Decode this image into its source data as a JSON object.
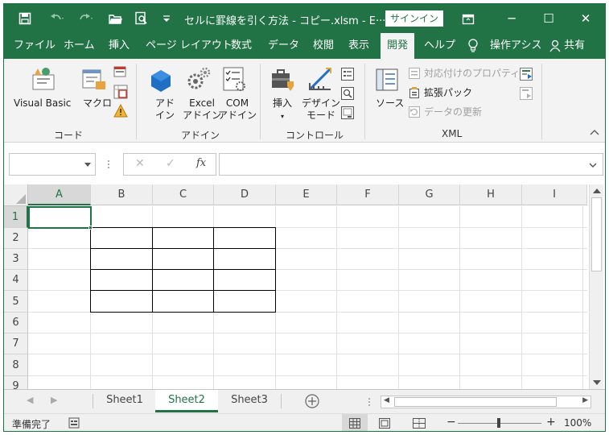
{
  "titlebar": {
    "title": "セルに罫線を引く方法 - コピー.xlsm  -  E···",
    "signin_label": "サインイン",
    "minimize_glyph": "─",
    "maximize_glyph": "☐",
    "close_glyph": "✕"
  },
  "tabs": [
    "ファイル",
    "ホーム",
    "挿入",
    "ページ レイアウト",
    "数式",
    "データ",
    "校閲",
    "表示",
    "開発",
    "ヘルプ",
    "操作アシス",
    "共有"
  ],
  "active_tab": "開発",
  "ribbon": {
    "code_group": {
      "label": "コード",
      "visual_basic": "Visual Basic",
      "macro": "マクロ"
    },
    "addin_group": {
      "label": "アドイン",
      "addin_line1": "アド",
      "addin_line2": "イン",
      "excel_addin_line1": "Excel",
      "excel_addin_line2": "アドイン",
      "com_addin_line1": "COM",
      "com_addin_line2": "アドイン"
    },
    "controls_group": {
      "label": "コントロール",
      "insert": "挿入",
      "design_mode_line1": "デザイン",
      "design_mode_line2": "モード"
    },
    "xml_group": {
      "label": "XML",
      "source": "ソース",
      "map_properties": "対応付けのプロパティ",
      "expansion_packs": "拡張パック",
      "refresh_data": "データの更新"
    }
  },
  "formula_bar": {
    "name_box_value": "",
    "formula_value": "",
    "cancel_glyph": "✕",
    "enter_glyph": "✓",
    "fx_label": "fx"
  },
  "grid": {
    "columns": [
      "A",
      "B",
      "C",
      "D",
      "E",
      "F",
      "G",
      "H",
      "I"
    ],
    "rows": [
      "1",
      "2",
      "3",
      "4",
      "5",
      "6",
      "7",
      "8",
      "9"
    ],
    "selected_cell": "A1",
    "bordered_range": "B2:D5"
  },
  "sheets": [
    "Sheet1",
    "Sheet2",
    "Sheet3"
  ],
  "active_sheet": "Sheet2",
  "statusbar": {
    "status_text": "準備完了",
    "zoom_label": "100%",
    "zoom_minus": "−",
    "zoom_plus": "+"
  },
  "colors": {
    "accent": "#217346",
    "border_line": "#000000"
  }
}
